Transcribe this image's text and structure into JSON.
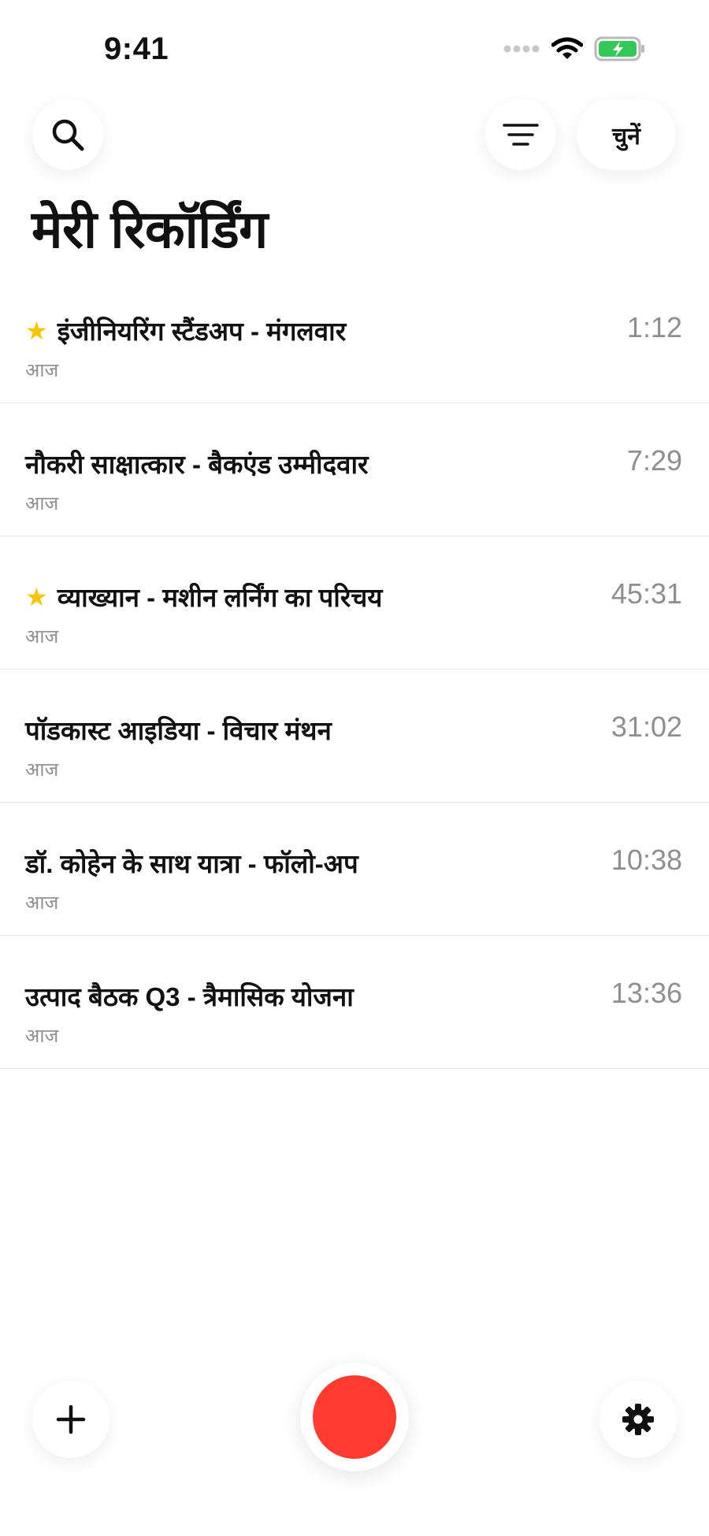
{
  "status_bar": {
    "time": "9:41",
    "battery_color": "#34c759"
  },
  "header": {
    "search_icon": "search-icon",
    "filter_icon": "filter-icon",
    "select_label": "चुनें",
    "title": "मेरी रिकॉर्डिंग"
  },
  "recordings": [
    {
      "title": "इंजीनियरिंग स्टैंडअप - मंगलवार",
      "date": "आज",
      "duration": "1:12",
      "starred": true
    },
    {
      "title": "नौकरी साक्षात्कार - बैकएंड उम्मीदवार",
      "date": "आज",
      "duration": "7:29",
      "starred": false
    },
    {
      "title": "व्याख्यान - मशीन लर्निंग का परिचय",
      "date": "आज",
      "duration": "45:31",
      "starred": true
    },
    {
      "title": "पॉडकास्ट आइडिया - विचार मंथन",
      "date": "आज",
      "duration": "31:02",
      "starred": false
    },
    {
      "title": "डॉ. कोहेन के साथ यात्रा - फॉलो-अप",
      "date": "आज",
      "duration": "10:38",
      "starred": false
    },
    {
      "title": "उत्पाद बैठक Q3 - त्रैमासिक योजना",
      "date": "आज",
      "duration": "13:36",
      "starred": false
    }
  ],
  "bottom_bar": {
    "add_icon": "plus-icon",
    "record_color": "#ff3b30",
    "settings_icon": "gear-icon"
  },
  "colors": {
    "star": "#f7c500",
    "secondary_text": "#8e8e93"
  }
}
